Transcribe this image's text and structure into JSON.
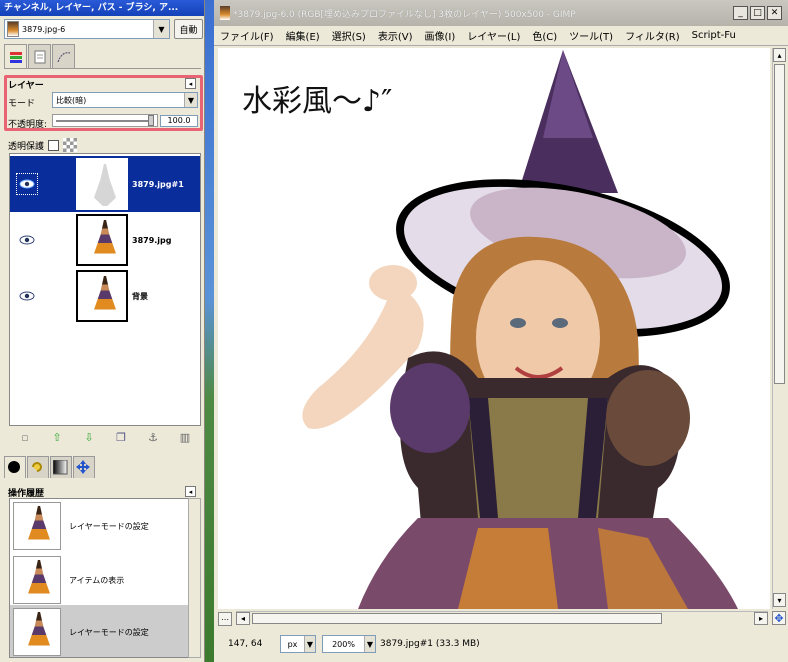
{
  "dock": {
    "title": "チャンネル, レイヤー, パス - ブラシ, ア...",
    "image_selector": "3879.jpg-6",
    "auto_button": "自動",
    "layers_panel": {
      "title": "レイヤー",
      "mode_label": "モード",
      "mode_value": "比較(暗)",
      "opacity_label": "不透明度:",
      "opacity_value": "100.0",
      "lock_label": "透明保護",
      "layers": [
        {
          "name": "3879.jpg#1",
          "visible": true,
          "selected": true
        },
        {
          "name": "3879.jpg",
          "visible": true,
          "selected": false
        },
        {
          "name": "背景",
          "visible": true,
          "selected": false
        }
      ]
    },
    "history_panel": {
      "title": "操作履歴",
      "items": [
        {
          "label": "レイヤーモードの設定",
          "selected": false
        },
        {
          "label": "アイテムの表示",
          "selected": false
        },
        {
          "label": "レイヤーモードの設定",
          "selected": true
        }
      ]
    }
  },
  "window": {
    "title": "*3879.jpg-6.0 (RGB[埋め込みプロファイルなし] 3枚のレイヤー) 500x500 - GIMP",
    "menu": [
      "ファイル(F)",
      "編集(E)",
      "選択(S)",
      "表示(V)",
      "画像(I)",
      "レイヤー(L)",
      "色(C)",
      "ツール(T)",
      "フィルタ(R)",
      "Script-Fu"
    ],
    "canvas_caption": "水彩風〜♪″",
    "status": {
      "coords": "147, 64",
      "unit": "px",
      "zoom": "200%",
      "info": "3879.jpg#1 (33.3 MB)"
    }
  },
  "colors": {
    "selection": "#0a2d9c",
    "highlight_box": "#e86472",
    "titlebar": "#1341b8"
  }
}
